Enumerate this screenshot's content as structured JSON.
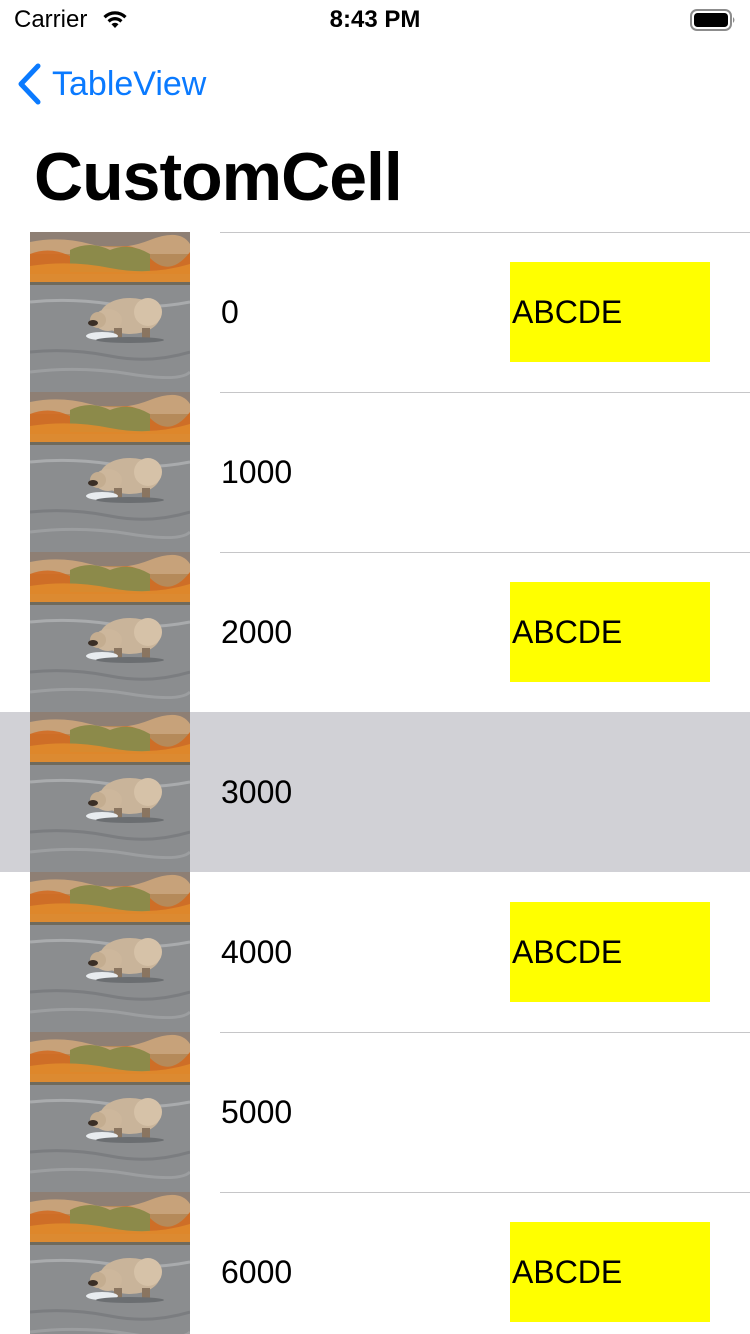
{
  "status_bar": {
    "carrier": "Carrier",
    "time": "8:43 PM"
  },
  "nav": {
    "back_label": "TableView",
    "title": "CustomCell"
  },
  "colors": {
    "accent": "#0a7aff",
    "badge": "#ffff00",
    "selected_row": "#d1d1d6"
  },
  "rows": [
    {
      "number": "0",
      "badge": "ABCDE"
    },
    {
      "number": "1000",
      "badge": ""
    },
    {
      "number": "2000",
      "badge": "ABCDE"
    },
    {
      "number": "3000",
      "badge": "",
      "selected": true
    },
    {
      "number": "4000",
      "badge": "ABCDE"
    },
    {
      "number": "5000",
      "badge": ""
    },
    {
      "number": "6000",
      "badge": "ABCDE"
    }
  ]
}
